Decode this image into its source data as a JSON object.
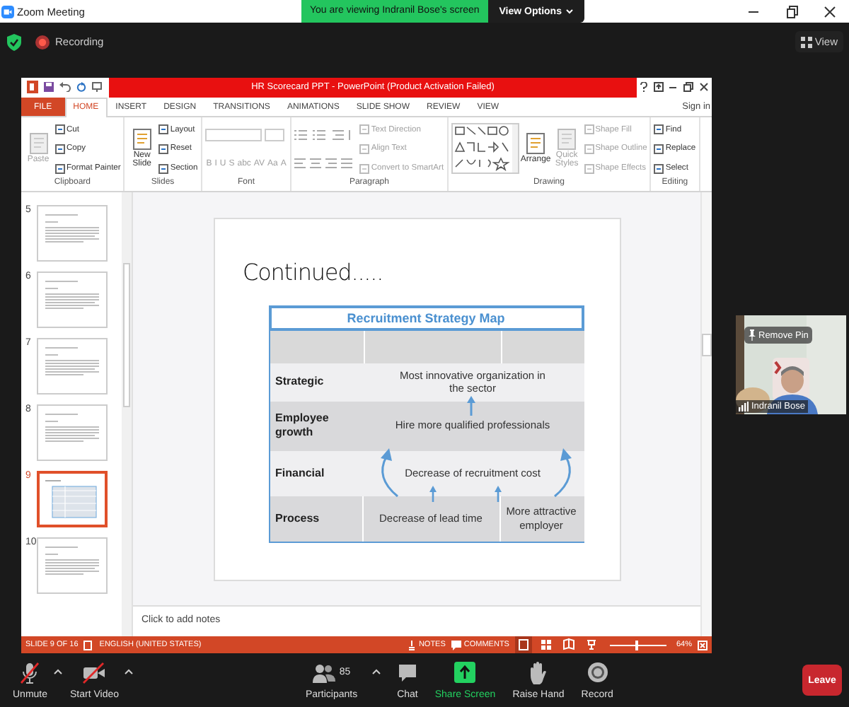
{
  "zoom_window": {
    "title": "Zoom Meeting",
    "banner": "You are viewing Indranil Bose's screen",
    "view_options": "View Options"
  },
  "meeting_bar": {
    "recording": "Recording",
    "view": "View"
  },
  "powerpoint": {
    "title": "HR Scorecard PPT - PowerPoint (Product Activation Failed)",
    "tabs": [
      {
        "label": "FILE",
        "kind": "backstage",
        "selected": false
      },
      {
        "label": "HOME",
        "kind": "tab",
        "selected": true
      },
      {
        "label": "INSERT",
        "kind": "tab",
        "selected": false
      },
      {
        "label": "DESIGN",
        "kind": "tab",
        "selected": false
      },
      {
        "label": "TRANSITIONS",
        "kind": "tab",
        "selected": false
      },
      {
        "label": "ANIMATIONS",
        "kind": "tab",
        "selected": false
      },
      {
        "label": "SLIDE SHOW",
        "kind": "tab",
        "selected": false
      },
      {
        "label": "REVIEW",
        "kind": "tab",
        "selected": false
      },
      {
        "label": "VIEW",
        "kind": "tab",
        "selected": false
      }
    ],
    "sign_in": "Sign in",
    "ribbon": [
      {
        "name": "Clipboard",
        "columns": [
          [
            {
              "kind": "large",
              "label": "Paste",
              "disabled": true
            }
          ],
          [
            {
              "kind": "small",
              "label": "Cut",
              "disabled": false
            },
            {
              "kind": "small",
              "label": "Copy",
              "disabled": false
            },
            {
              "kind": "small",
              "label": "Format Painter",
              "disabled": false
            }
          ]
        ]
      },
      {
        "name": "Slides",
        "columns": [
          [
            {
              "kind": "large",
              "label": "New Slide",
              "disabled": false
            }
          ],
          [
            {
              "kind": "small",
              "label": "Layout",
              "disabled": false
            },
            {
              "kind": "small",
              "label": "Reset",
              "disabled": false
            },
            {
              "kind": "small",
              "label": "Section",
              "disabled": false
            }
          ]
        ]
      },
      {
        "name": "Font",
        "columns": [
          [
            {
              "kind": "font-boxes"
            },
            {
              "kind": "glyphs",
              "disabled": true,
              "labels": [
                "B",
                "I",
                "U",
                "S",
                "abc",
                "AV",
                "Aa",
                "A"
              ]
            }
          ]
        ]
      },
      {
        "name": "Paragraph",
        "columns": [
          [
            {
              "kind": "list-buttons"
            },
            {
              "kind": "align-buttons"
            }
          ],
          [
            {
              "kind": "small",
              "label": "Text Direction",
              "disabled": true
            },
            {
              "kind": "small",
              "label": "Align Text",
              "disabled": true
            },
            {
              "kind": "small",
              "label": "Convert to SmartArt",
              "disabled": true
            }
          ]
        ]
      },
      {
        "name": "Drawing",
        "columns": [
          [
            {
              "kind": "shapes"
            }
          ],
          [
            {
              "kind": "large",
              "label": "Arrange",
              "disabled": false
            }
          ],
          [
            {
              "kind": "large",
              "label": "Quick Styles",
              "disabled": true
            }
          ],
          [
            {
              "kind": "small",
              "label": "Shape Fill",
              "disabled": true
            },
            {
              "kind": "small",
              "label": "Shape Outline",
              "disabled": true
            },
            {
              "kind": "small",
              "label": "Shape Effects",
              "disabled": true
            }
          ]
        ]
      },
      {
        "name": "Editing",
        "columns": [
          [
            {
              "kind": "small",
              "label": "Find",
              "disabled": false
            },
            {
              "kind": "small",
              "label": "Replace",
              "disabled": false
            },
            {
              "kind": "small",
              "label": "Select",
              "disabled": false
            }
          ]
        ]
      }
    ],
    "slides": [
      {
        "number": "5",
        "kind": "text",
        "selected": false
      },
      {
        "number": "6",
        "kind": "text",
        "selected": false
      },
      {
        "number": "7",
        "kind": "text",
        "selected": false
      },
      {
        "number": "8",
        "kind": "text",
        "selected": false
      },
      {
        "number": "9",
        "kind": "table",
        "selected": true
      },
      {
        "number": "10",
        "kind": "text",
        "selected": false
      }
    ],
    "slide": {
      "title": "Continued.....",
      "table": {
        "title": "Recruitment Strategy Map",
        "rows": [
          {
            "label": "Strategic",
            "cells": [
              "Most innovative organization in the sector"
            ]
          },
          {
            "label": "Employee growth",
            "cells": [
              "Hire more qualified professionals"
            ]
          },
          {
            "label": "Financial",
            "cells": [
              "Decrease of recruitment cost"
            ]
          },
          {
            "label": "Process",
            "cells": [
              "Decrease of lead time",
              "More attractive employer"
            ]
          }
        ]
      }
    },
    "notes_placeholder": "Click to add notes",
    "status_bar": {
      "slide": "SLIDE 9 OF 16",
      "language": "ENGLISH (UNITED STATES)",
      "notes": "NOTES",
      "comments": "COMMENTS",
      "zoom": "64%",
      "zoom_slider": {
        "level": 0.45
      }
    }
  },
  "video_tile": {
    "remove_pin": "Remove Pin",
    "name": "Indranil Bose"
  },
  "toolbar": [
    {
      "kind": "mic",
      "label": "Unmute",
      "muted": true
    },
    {
      "kind": "camera",
      "label": "Start Video",
      "off": true
    },
    {
      "kind": "participants",
      "label": "Participants",
      "count": "85"
    },
    {
      "kind": "chat",
      "label": "Chat"
    },
    {
      "kind": "share",
      "label": "Share Screen"
    },
    {
      "kind": "hand",
      "label": "Raise Hand"
    },
    {
      "kind": "record",
      "label": "Record"
    }
  ],
  "leave": "Leave"
}
